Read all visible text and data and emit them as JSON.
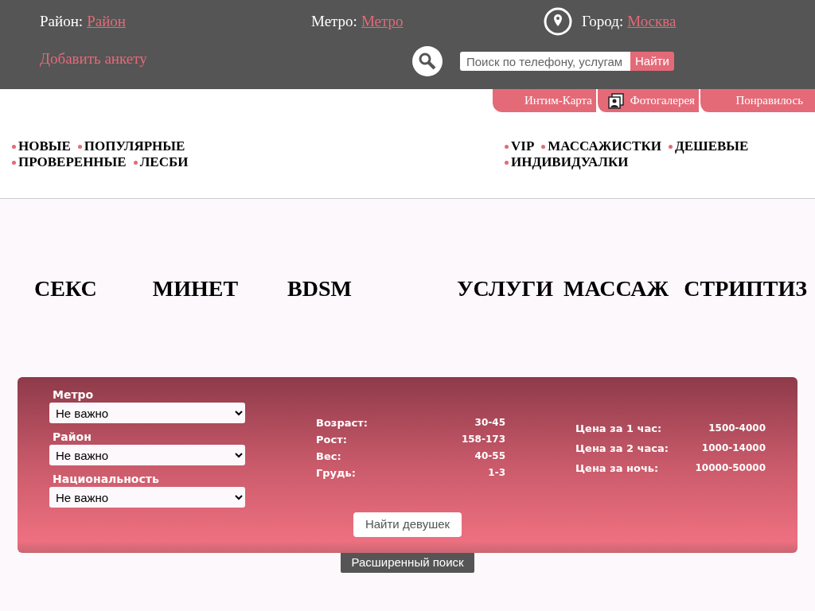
{
  "header": {
    "location": [
      {
        "kind": "plain",
        "label": "Район:",
        "value": "Район"
      },
      {
        "kind": "plain",
        "label": "Метро:",
        "value": "Метро"
      },
      {
        "kind": "pin",
        "label": "Город:",
        "value": "Москва"
      }
    ],
    "add_listing": "Добавить анкету",
    "search": {
      "placeholder": "Поиск по телефону, услугам",
      "button": "Найти"
    }
  },
  "top_tabs": [
    {
      "kind": "plain",
      "label": "Интим-Карта"
    },
    {
      "kind": "gallery",
      "label": "Фотогалерея"
    },
    {
      "kind": "plain",
      "label": "Понравилось"
    }
  ],
  "nav_left": [
    [
      "НОВЫЕ",
      "ПОПУЛЯРНЫЕ"
    ],
    [
      "ПРОВЕРЕННЫЕ",
      "ЛЕСБИ"
    ]
  ],
  "nav_right": [
    [
      "VIP",
      "МАССАЖИСТКИ",
      "ДЕШЕВЫЕ"
    ],
    [
      "ИНДИВИДУАЛКИ"
    ]
  ],
  "categories": [
    "СЕКС",
    "МИНЕТ",
    "BDSM",
    "УСЛУГИ",
    "МАССАЖ",
    "СТРИПТИЗ"
  ],
  "filter": {
    "selects": [
      {
        "label": "Метро",
        "value": "Не важно"
      },
      {
        "label": "Район",
        "value": "Не важно"
      },
      {
        "label": "Национальность",
        "value": "Не важно"
      }
    ],
    "params": [
      {
        "label": "Возраст:",
        "value": "30-45"
      },
      {
        "label": "Рост:",
        "value": "158-173"
      },
      {
        "label": "Вес:",
        "value": "40-55"
      },
      {
        "label": "Грудь:",
        "value": "1-3"
      }
    ],
    "prices": [
      {
        "label": "Цена за 1 час:",
        "value": "1500-4000"
      },
      {
        "label": "Цена за 2 часа:",
        "value": "1000-14000"
      },
      {
        "label": "Цена за ночь:",
        "value": "10000-50000"
      }
    ],
    "submit": "Найти девушек",
    "advanced": "Расширенный поиск"
  }
}
